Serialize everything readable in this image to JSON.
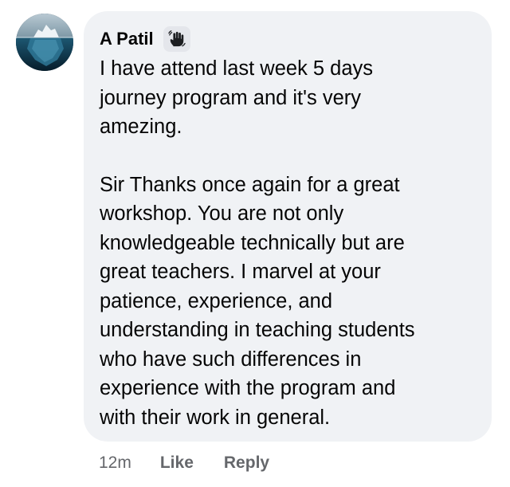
{
  "comment": {
    "author": "A Patil",
    "badge_icon": "hand-wave-icon",
    "paragraph_1": "I have attend last week 5 days\njourney program and it's very\namezing.",
    "paragraph_2": "Sir Thanks once again for a great\nworkshop. You are not only\nknowledgeable technically but are\ngreat teachers. I marvel at your\npatience, experience, and\nunderstanding in teaching students\nwho have such differences in\nexperience with the program and\nwith their work in general.",
    "timestamp": "12m",
    "like_label": "Like",
    "reply_label": "Reply"
  },
  "colors": {
    "bubble_bg": "#f0f2f5",
    "text": "#050505",
    "meta_text": "#65676b",
    "badge_bg": "#e4e6eb"
  }
}
